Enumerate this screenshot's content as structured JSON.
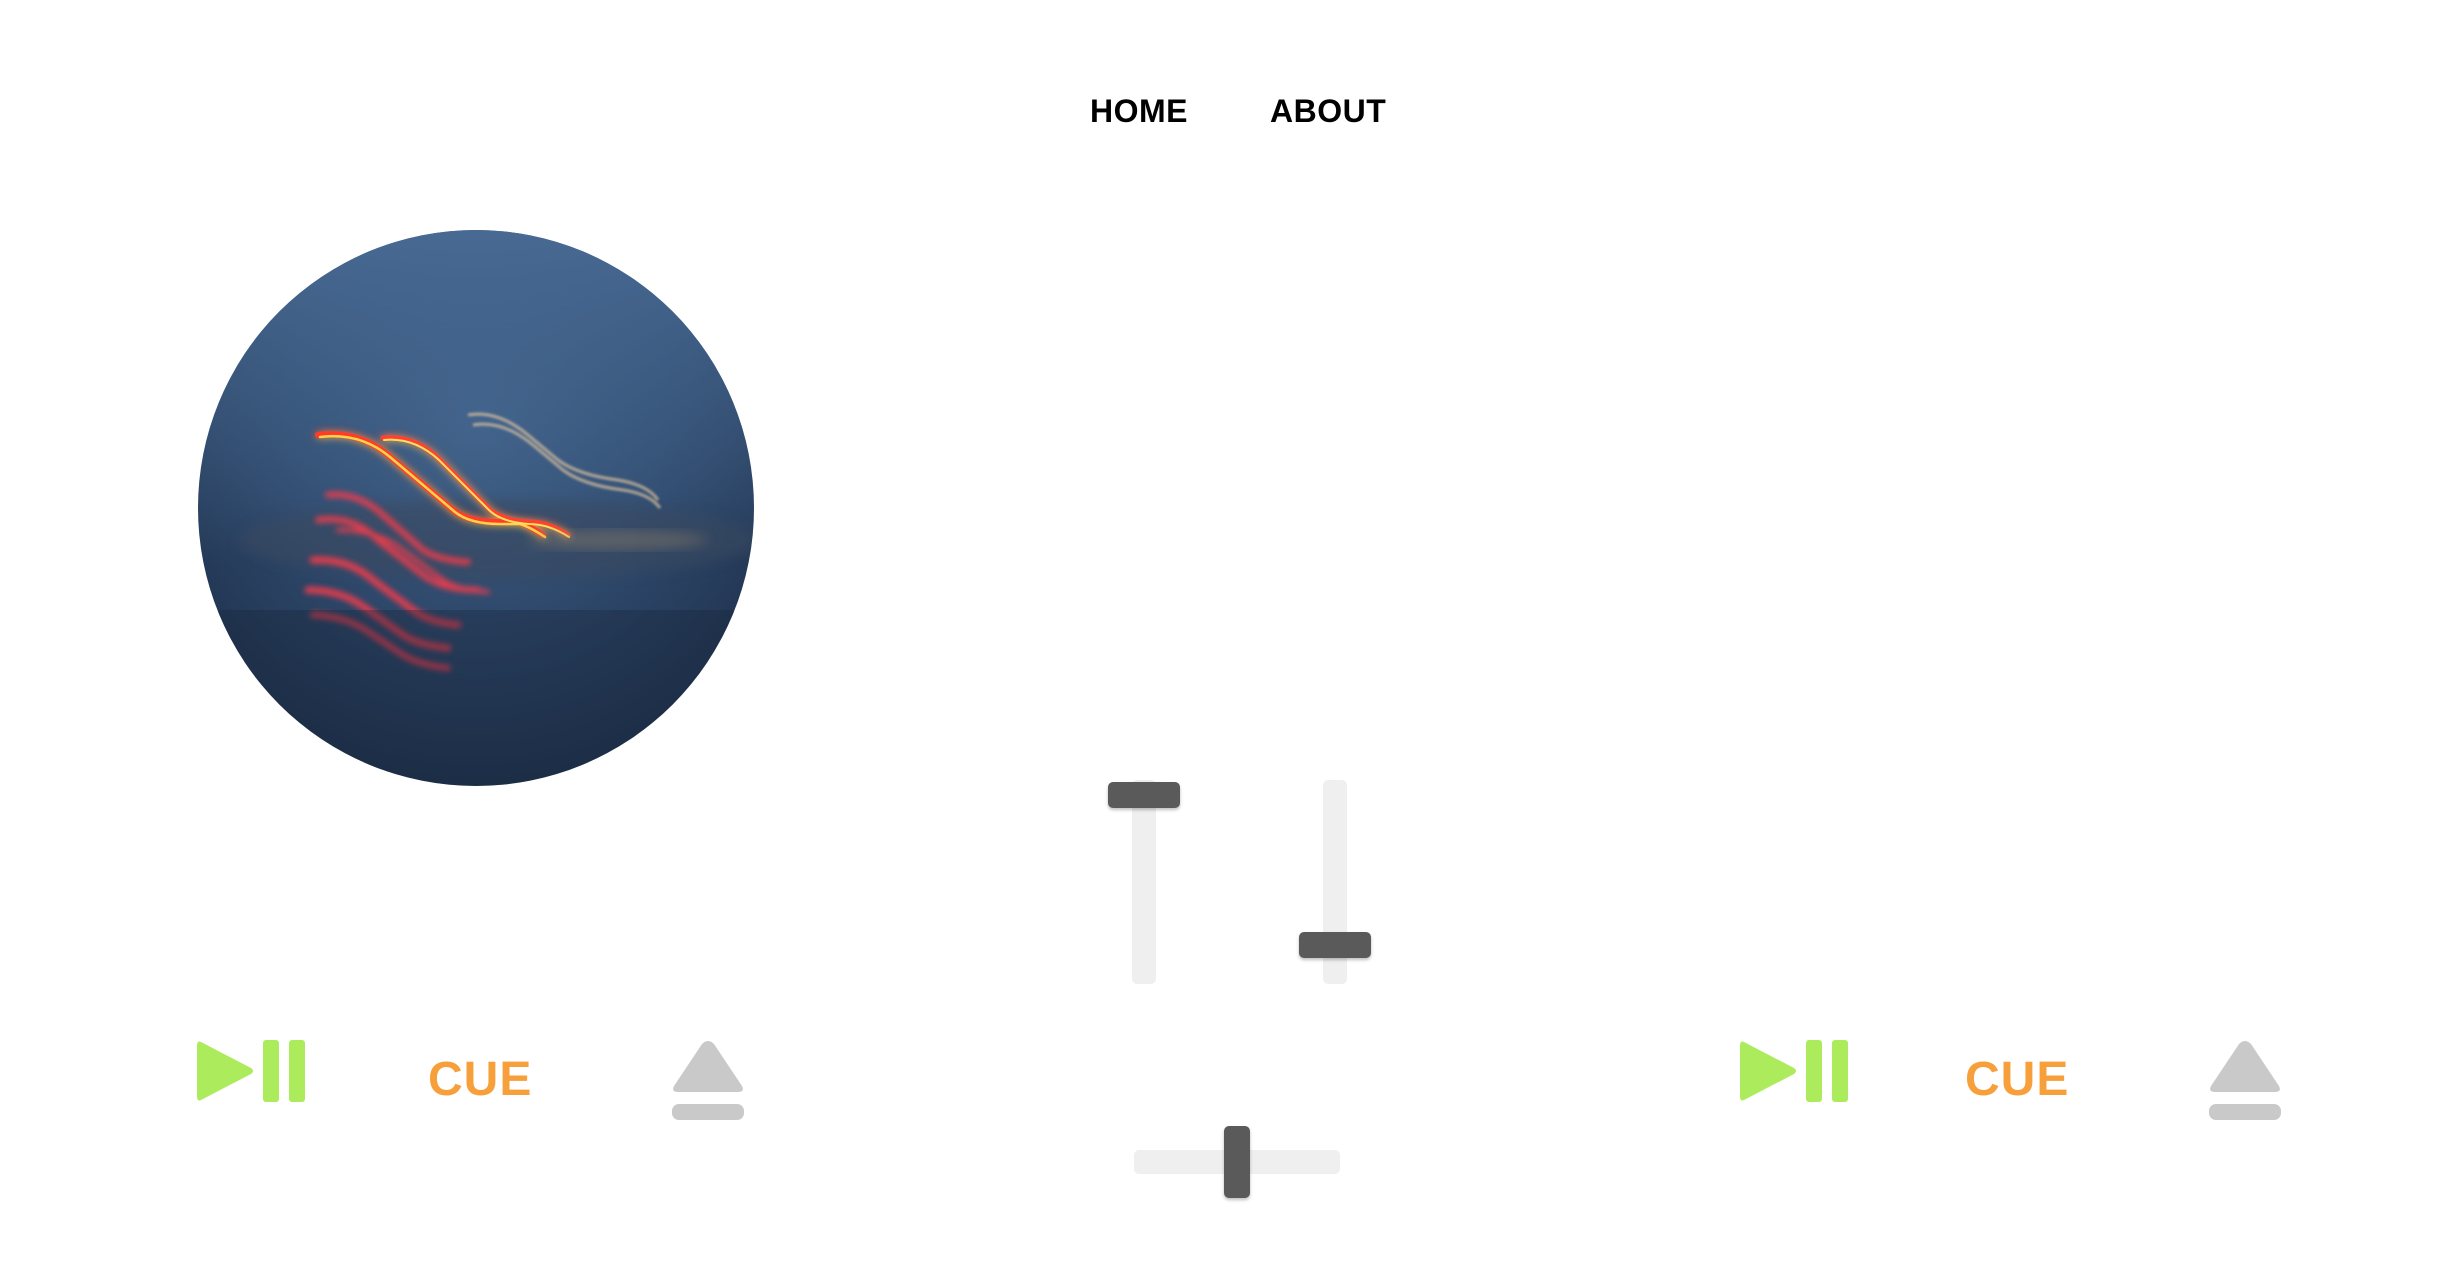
{
  "nav": {
    "home_label": "HOME",
    "about_label": "ABOUT"
  },
  "deck_left": {
    "disc_image": "neon-light-trails-artwork",
    "play_pause_icon": "play-pause-icon",
    "cue_label": "CUE",
    "eject_icon": "eject-icon"
  },
  "deck_right": {
    "play_pause_icon": "play-pause-icon",
    "cue_label": "CUE",
    "eject_icon": "eject-icon"
  },
  "mixer": {
    "left_channel_volume": 1.0,
    "right_channel_volume": 0.12,
    "crossfader_position": 0.5
  },
  "colors": {
    "play_pause": "#acec5c",
    "cue": "#f7a03b",
    "eject": "#c9c9c9",
    "fader_track": "#efefef",
    "fader_handle": "#5a5a5a"
  }
}
